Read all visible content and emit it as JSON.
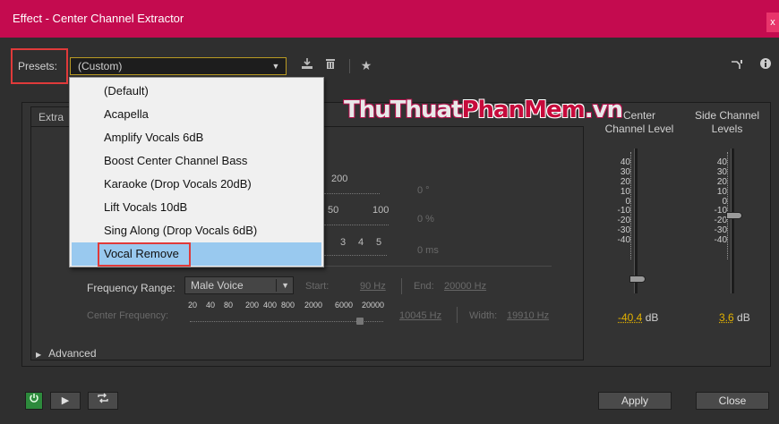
{
  "window": {
    "title": "Effect - Center Channel Extractor",
    "close_glyph": "x"
  },
  "presets": {
    "label": "Presets:",
    "selected": "(Custom)",
    "items": [
      "(Default)",
      "Acapella",
      "Amplify Vocals 6dB",
      "Boost Center Channel Bass",
      "Karaoke (Drop Vocals 20dB)",
      "Lift Vocals 10dB",
      "Sing Along (Drop Vocals 6dB)",
      "Vocal Remove"
    ],
    "highlighted_index": 7
  },
  "tabs": {
    "extraction": "Extra"
  },
  "watermark": {
    "part1": "ThuThuat",
    "part2": "PhanMem",
    "part3": ".vn"
  },
  "hidden_controls": {
    "phase_scale_max": "200",
    "phase_value": "0 °",
    "percent_scale_mid": "50",
    "percent_scale_max": "100",
    "percent_value": "0 %",
    "delay_scale": [
      "3",
      "4",
      "5"
    ],
    "delay_value": "0 ms"
  },
  "frequency_range": {
    "label": "Frequency Range:",
    "value": "Male Voice",
    "start_label": "Start:",
    "start_value": "90 Hz",
    "end_label": "End:",
    "end_value": "20000 Hz"
  },
  "center_frequency": {
    "label": "Center Frequency:",
    "scale": [
      "20",
      "40",
      "80",
      "200",
      "400",
      "800",
      "2000",
      "6000",
      "20000"
    ],
    "value": "10045 Hz",
    "width_label": "Width:",
    "width_value": "19910 Hz"
  },
  "meters": {
    "scale": [
      "40",
      "30",
      "20",
      "10",
      "0",
      "-10",
      "-20",
      "-30",
      "-40"
    ],
    "center": {
      "title_line1": "Center",
      "title_line2": "Channel Level",
      "value": "-40.4",
      "unit": "dB"
    },
    "side": {
      "title_line1": "Side Channel",
      "title_line2": "Levels",
      "value": "3.6",
      "unit": "dB"
    }
  },
  "advanced": {
    "label": "Advanced"
  },
  "buttons": {
    "apply": "Apply",
    "close": "Close"
  },
  "icons": [
    "power-icon",
    "play-icon",
    "loop-icon",
    "save-preset-icon",
    "delete-preset-icon",
    "favorite-star-icon",
    "route-icon",
    "info-icon"
  ]
}
